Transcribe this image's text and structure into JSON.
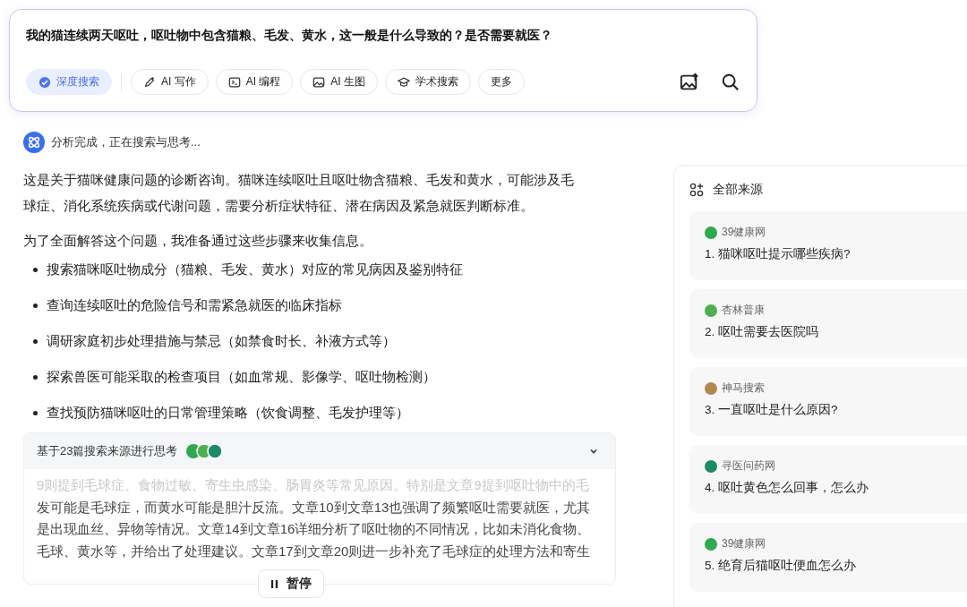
{
  "query": {
    "text": "我的猫连续两天呕吐，呕吐物中包含猫粮、毛发、黄水，这一般是什么导致的？是否需要就医？"
  },
  "tools": [
    {
      "label": "深度搜索",
      "kind": "check",
      "selected": true
    },
    {
      "label": "AI 写作",
      "kind": "pen",
      "selected": false
    },
    {
      "label": "AI 编程",
      "kind": "code",
      "selected": false
    },
    {
      "label": "AI 生图",
      "kind": "image",
      "selected": false
    },
    {
      "label": "学术搜索",
      "kind": "cap",
      "selected": false
    },
    {
      "label": "更多",
      "kind": "none",
      "selected": false
    }
  ],
  "status": {
    "text": "分析完成，正在搜索与思考..."
  },
  "paragraphs": [
    "这是关于猫咪健康问题的诊断咨询。猫咪连续呕吐且呕吐物含猫粮、毛发和黄水，可能涉及毛球症、消化系统疾病或代谢问题，需要分析症状特征、潜在病因及紧急就医判断标准。",
    "为了全面解答这个问题，我准备通过这些步骤来收集信息。"
  ],
  "steps": [
    "搜索猫咪呕吐物成分（猫粮、毛发、黄水）对应的常见病因及鉴别特征",
    "查询连续呕吐的危险信号和需紧急就医的临床指标",
    "调研家庭初步处理措施与禁忌（如禁食时长、补液方式等）",
    "探索兽医可能采取的检查项目（如血常规、影像学、呕吐物检测）",
    "查找预防猫咪呕吐的日常管理策略（饮食调整、毛发护理等）"
  ],
  "thinking": {
    "title": "基于23篇搜索来源进行思考",
    "expanded": true,
    "lines": [
      "9则提到毛球症、食物过敏、寄生虫感染、肠胃炎等常见原因。特别是文章9提到呕吐物中的毛",
      "发可能是毛球症，而黄水可能是胆汁反流。文章10到文章13也强调了频繁呕吐需要就医，尤其",
      "是出现血丝、异物等情况。文章14到文章16详细分析了呕吐物的不同情况，比如未消化食物、",
      "毛球、黄水等，并给出了处理建议。文章17到文章20则进一步补充了毛球症的处理方法和寄生"
    ]
  },
  "pause_button": {
    "label": "暂停"
  },
  "sources_panel": {
    "title": "全部来源",
    "sources": [
      {
        "site": "39健康网",
        "title": "1. 猫咪呕吐提示哪些疾病?",
        "color": "#2fa84f"
      },
      {
        "site": "杏林普康",
        "title": "2. 呕吐需要去医院吗",
        "color": "#4caf50"
      },
      {
        "site": "神马搜索",
        "title": "3. 一直呕吐是什么原因?",
        "color": "#b08850"
      },
      {
        "site": "寻医问药网",
        "title": "4. 呕吐黄色怎么回事，怎么办",
        "color": "#1f8a6a"
      },
      {
        "site": "39健康网",
        "title": "5. 绝育后猫呕吐便血怎么办",
        "color": "#2fa84f"
      }
    ]
  }
}
